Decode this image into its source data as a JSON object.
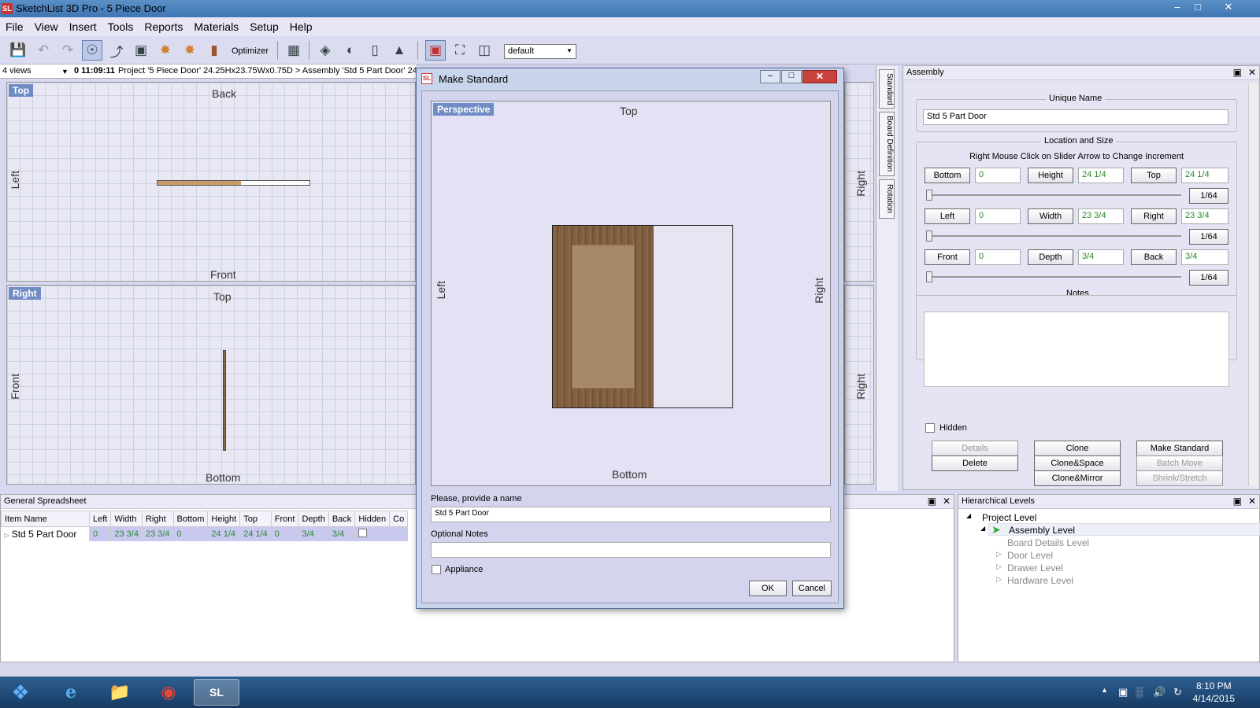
{
  "window": {
    "title": "SketchList 3D Pro - 5 Piece Door",
    "minimize": "–",
    "maximize": "□",
    "close": "✕"
  },
  "menu": [
    "File",
    "View",
    "Insert",
    "Tools",
    "Reports",
    "Materials",
    "Setup",
    "Help"
  ],
  "toolbar": {
    "optimizer_label": "Optimizer",
    "layout_select": "default"
  },
  "infobar": {
    "views": "4 views",
    "time": "0 11:09:11",
    "path": "Project '5 Piece Door' 24.25Hx23.75Wx0.75D > Assembly 'Std 5 Part Door' 24.25H"
  },
  "views": {
    "top": {
      "tag": "Top",
      "back": "Back",
      "front": "Front",
      "left": "Left",
      "right": "Right"
    },
    "right": {
      "tag": "Right",
      "top": "Top",
      "bottom": "Bottom",
      "front": "Front",
      "right": "Right"
    }
  },
  "side_tabs": [
    "Standard",
    "Board Definition",
    "Rotation"
  ],
  "assembly": {
    "title": "Assembly",
    "unique_name_title": "Unique Name",
    "unique_name": "Std 5 Part Door",
    "loc_title": "Location and Size",
    "loc_hint": "Right Mouse Click on Slider Arrow to Change Increment",
    "rows": [
      {
        "a": "Bottom",
        "av": "0",
        "b": "Height",
        "bv": "24 1/4",
        "c": "Top",
        "cv": "24 1/4",
        "inc": "1/64"
      },
      {
        "a": "Left",
        "av": "0",
        "b": "Width",
        "bv": "23 3/4",
        "c": "Right",
        "cv": "23 3/4",
        "inc": "1/64"
      },
      {
        "a": "Front",
        "av": "0",
        "b": "Depth",
        "bv": "3/4",
        "c": "Back",
        "cv": "3/4",
        "inc": "1/64"
      }
    ],
    "notes_title": "Notes",
    "hidden": "Hidden",
    "buttons": {
      "details": "Details",
      "delete": "Delete",
      "clone": "Clone",
      "clone_space": "Clone&Space",
      "clone_mirror": "Clone&Mirror",
      "make_standard": "Make Standard",
      "batch_move": "Batch Move",
      "shrink": "Shrink/Stretch"
    }
  },
  "dialog": {
    "title": "Make Standard",
    "view_tag": "Perspective",
    "top": "Top",
    "bottom": "Bottom",
    "left": "Left",
    "right": "Right",
    "name_label": "Please, provide a name",
    "name_value": "Std 5 Part Door",
    "notes_label": "Optional Notes",
    "notes_value": "",
    "appliance": "Appliance",
    "ok": "OK",
    "cancel": "Cancel"
  },
  "spreadsheet": {
    "title": "General Spreadsheet",
    "columns": [
      "Item Name",
      "Left",
      "Width",
      "Right",
      "Bottom",
      "Height",
      "Top",
      "Front",
      "Depth",
      "Back",
      "Hidden",
      "Co"
    ],
    "row": [
      "Std 5 Part Door",
      "0",
      "23 3/4",
      "23 3/4",
      "0",
      "24 1/4",
      "24 1/4",
      "0",
      "3/4",
      "3/4"
    ]
  },
  "hierarchy": {
    "title": "Hierarchical Levels",
    "items": [
      "Project Level",
      "Assembly Level",
      "Board Details Level",
      "Door Level",
      "Drawer Level",
      "Hardware Level"
    ]
  },
  "taskbar": {
    "time": "8:10 PM",
    "date": "4/14/2015"
  }
}
